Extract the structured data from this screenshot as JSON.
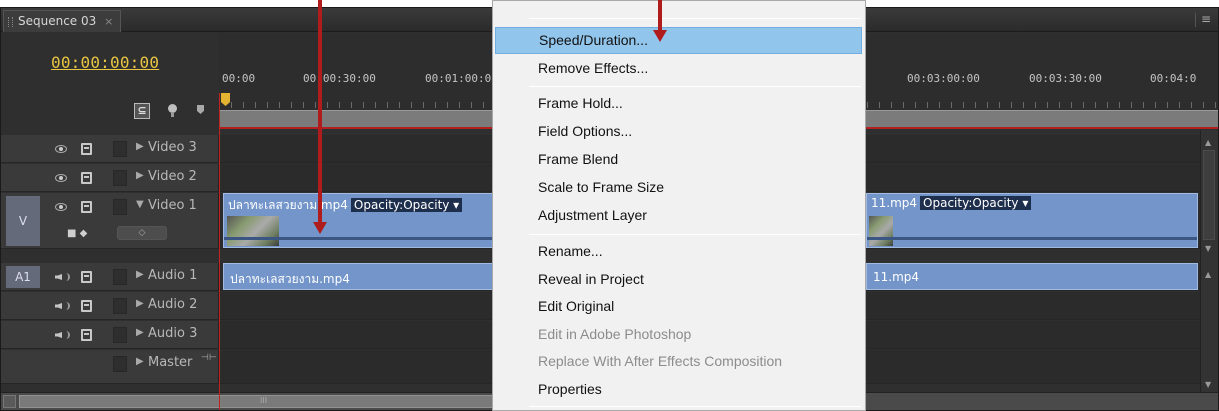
{
  "panel": {
    "tab_label": "Sequence 03",
    "tab_close": "×",
    "menu_icon": "≡"
  },
  "header": {
    "timecode": "00:00:00:00",
    "icons": [
      "snap-icon",
      "marker-icon",
      "keyframe-icon"
    ],
    "snap_glyph": "⊆"
  },
  "ruler": {
    "labels": [
      "00:00",
      "00:00:30:00",
      "00:01:00:0",
      "00:03:00:00",
      "00:03:30:00",
      "00:04:0"
    ]
  },
  "tracks": {
    "video3": {
      "name": "Video 3",
      "arrow": "▶"
    },
    "video2": {
      "name": "Video 2",
      "arrow": "▶"
    },
    "video1": {
      "name": "Video 1",
      "arrow": "▼",
      "target": "V",
      "keyframe_glyph": "◇"
    },
    "audio1": {
      "name": "Audio 1",
      "arrow": "▶",
      "target": "A1"
    },
    "audio2": {
      "name": "Audio 2",
      "arrow": "▶"
    },
    "audio3": {
      "name": "Audio 3",
      "arrow": "▶"
    },
    "master": {
      "name": "Master",
      "arrow": "▶",
      "sync_glyph": "⊣⊢"
    }
  },
  "clips": {
    "video_a": {
      "name": "ปลาทะเลสวยงาม.mp4",
      "effect": "Opacity:Opacity ▾"
    },
    "video_b": {
      "name": "11.mp4",
      "effect": "Opacity:Opacity ▾"
    },
    "audio_a": {
      "name": "ปลาทะเลสวยงาม.mp4"
    },
    "audio_b": {
      "name": "11.mp4"
    }
  },
  "scroll": {
    "grip": "III"
  },
  "context_menu": {
    "items": [
      {
        "label": "Speed/Duration...",
        "state": "hover"
      },
      {
        "label": "Remove Effects...",
        "state": "normal"
      },
      {
        "label": "Frame Hold...",
        "state": "normal"
      },
      {
        "label": "Field Options...",
        "state": "normal"
      },
      {
        "label": "Frame Blend",
        "state": "normal"
      },
      {
        "label": "Scale to Frame Size",
        "state": "normal"
      },
      {
        "label": "Adjustment Layer",
        "state": "normal"
      },
      {
        "label": "Rename...",
        "state": "normal"
      },
      {
        "label": "Reveal in Project",
        "state": "normal"
      },
      {
        "label": "Edit Original",
        "state": "normal"
      },
      {
        "label": "Edit in Adobe Photoshop",
        "state": "disabled"
      },
      {
        "label": "Replace With After Effects Composition",
        "state": "disabled"
      },
      {
        "label": "Properties",
        "state": "normal"
      }
    ]
  },
  "colors": {
    "timecode": "#e8c542",
    "clip": "#7395c9",
    "playhead": "#c12323",
    "annotation_arrow": "#b01b1b",
    "menu_hover": "#92c5ec"
  }
}
